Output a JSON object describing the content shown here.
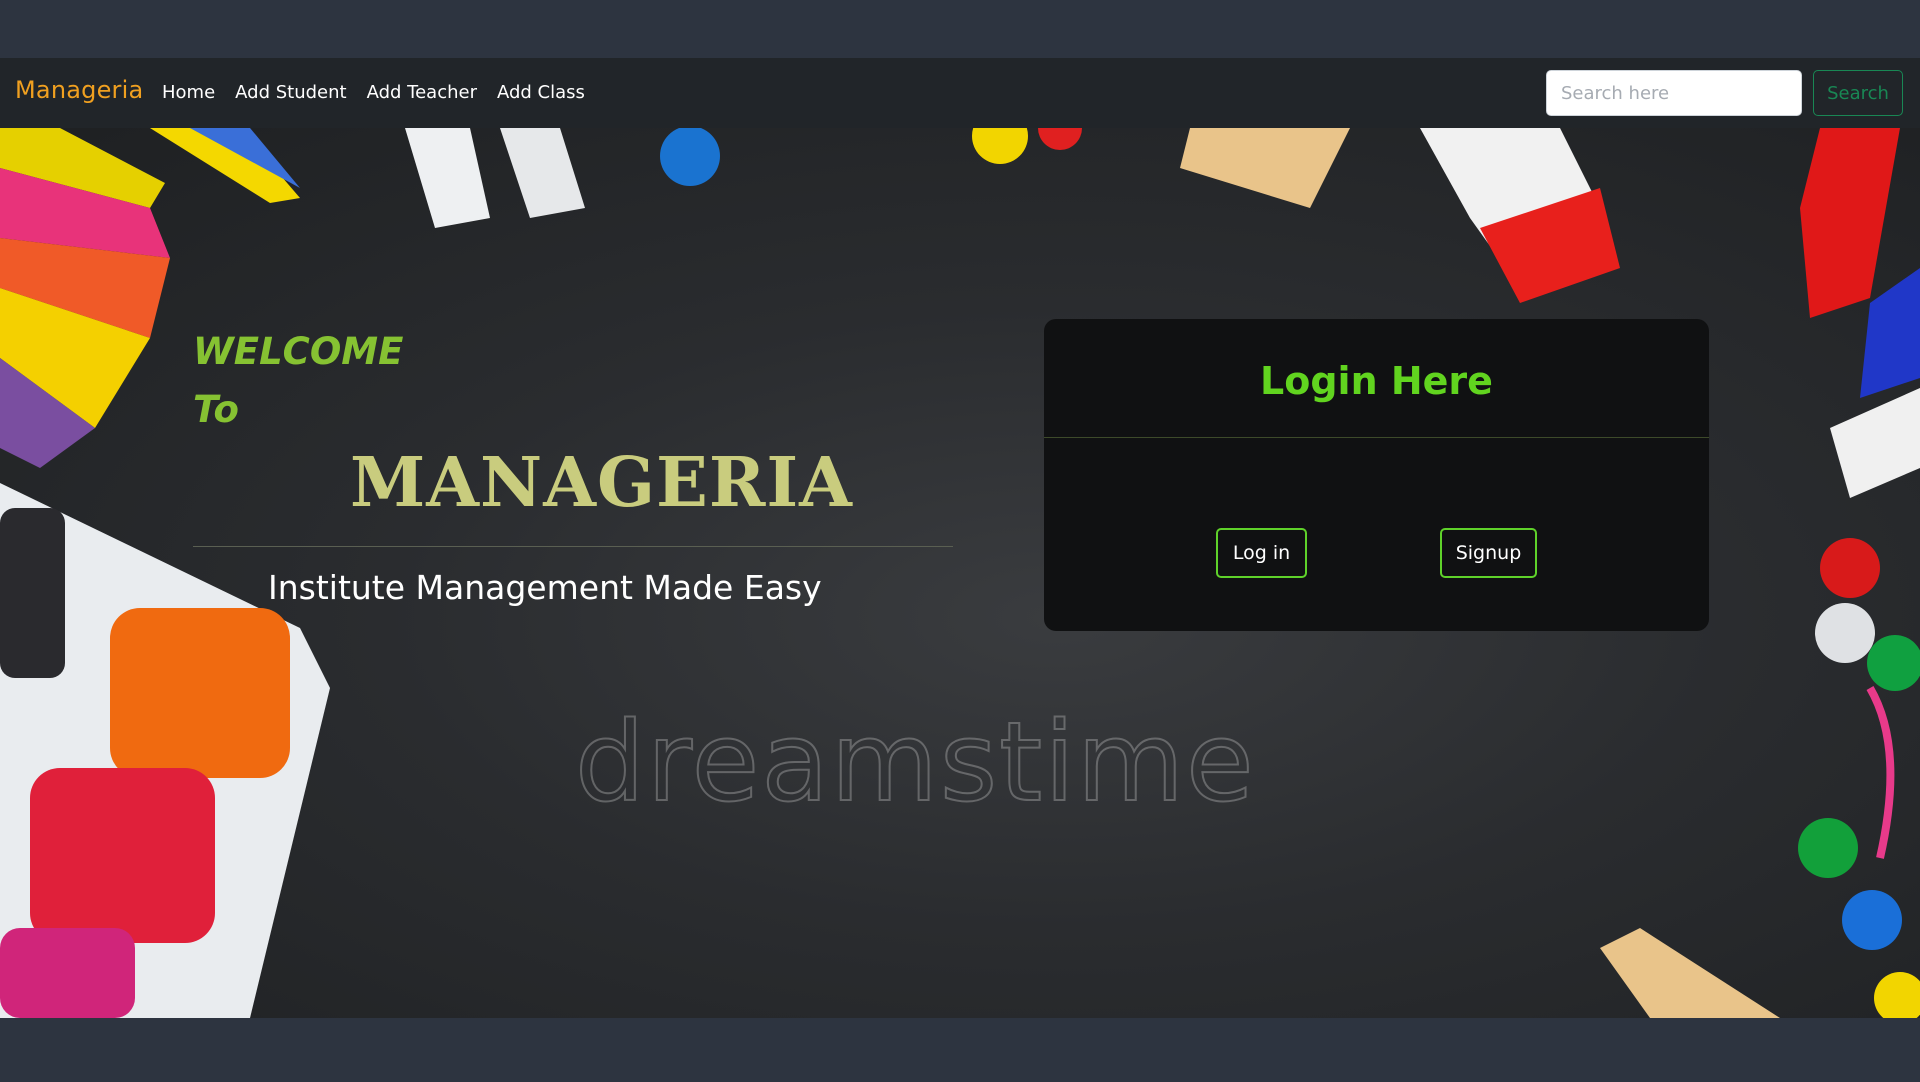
{
  "navbar": {
    "brand": "Manageria",
    "links": [
      "Home",
      "Add Student",
      "Add Teacher",
      "Add Class"
    ],
    "search_placeholder": "Search here",
    "search_button": "Search"
  },
  "hero": {
    "welcome_line1": "WELCOME",
    "welcome_line2": "To",
    "title": "MANAGERIA",
    "tagline": "Institute Management Made Easy",
    "watermark": "dreamstime"
  },
  "login": {
    "title": "Login Here",
    "login_button": "Log in",
    "signup_button": "Signup"
  },
  "colors": {
    "brand": "#f0a020",
    "welcome": "#86c232",
    "title": "#c9cc7e",
    "login_title": "#61d41f",
    "button_border": "#5fd22a",
    "search_button": "#198754"
  }
}
